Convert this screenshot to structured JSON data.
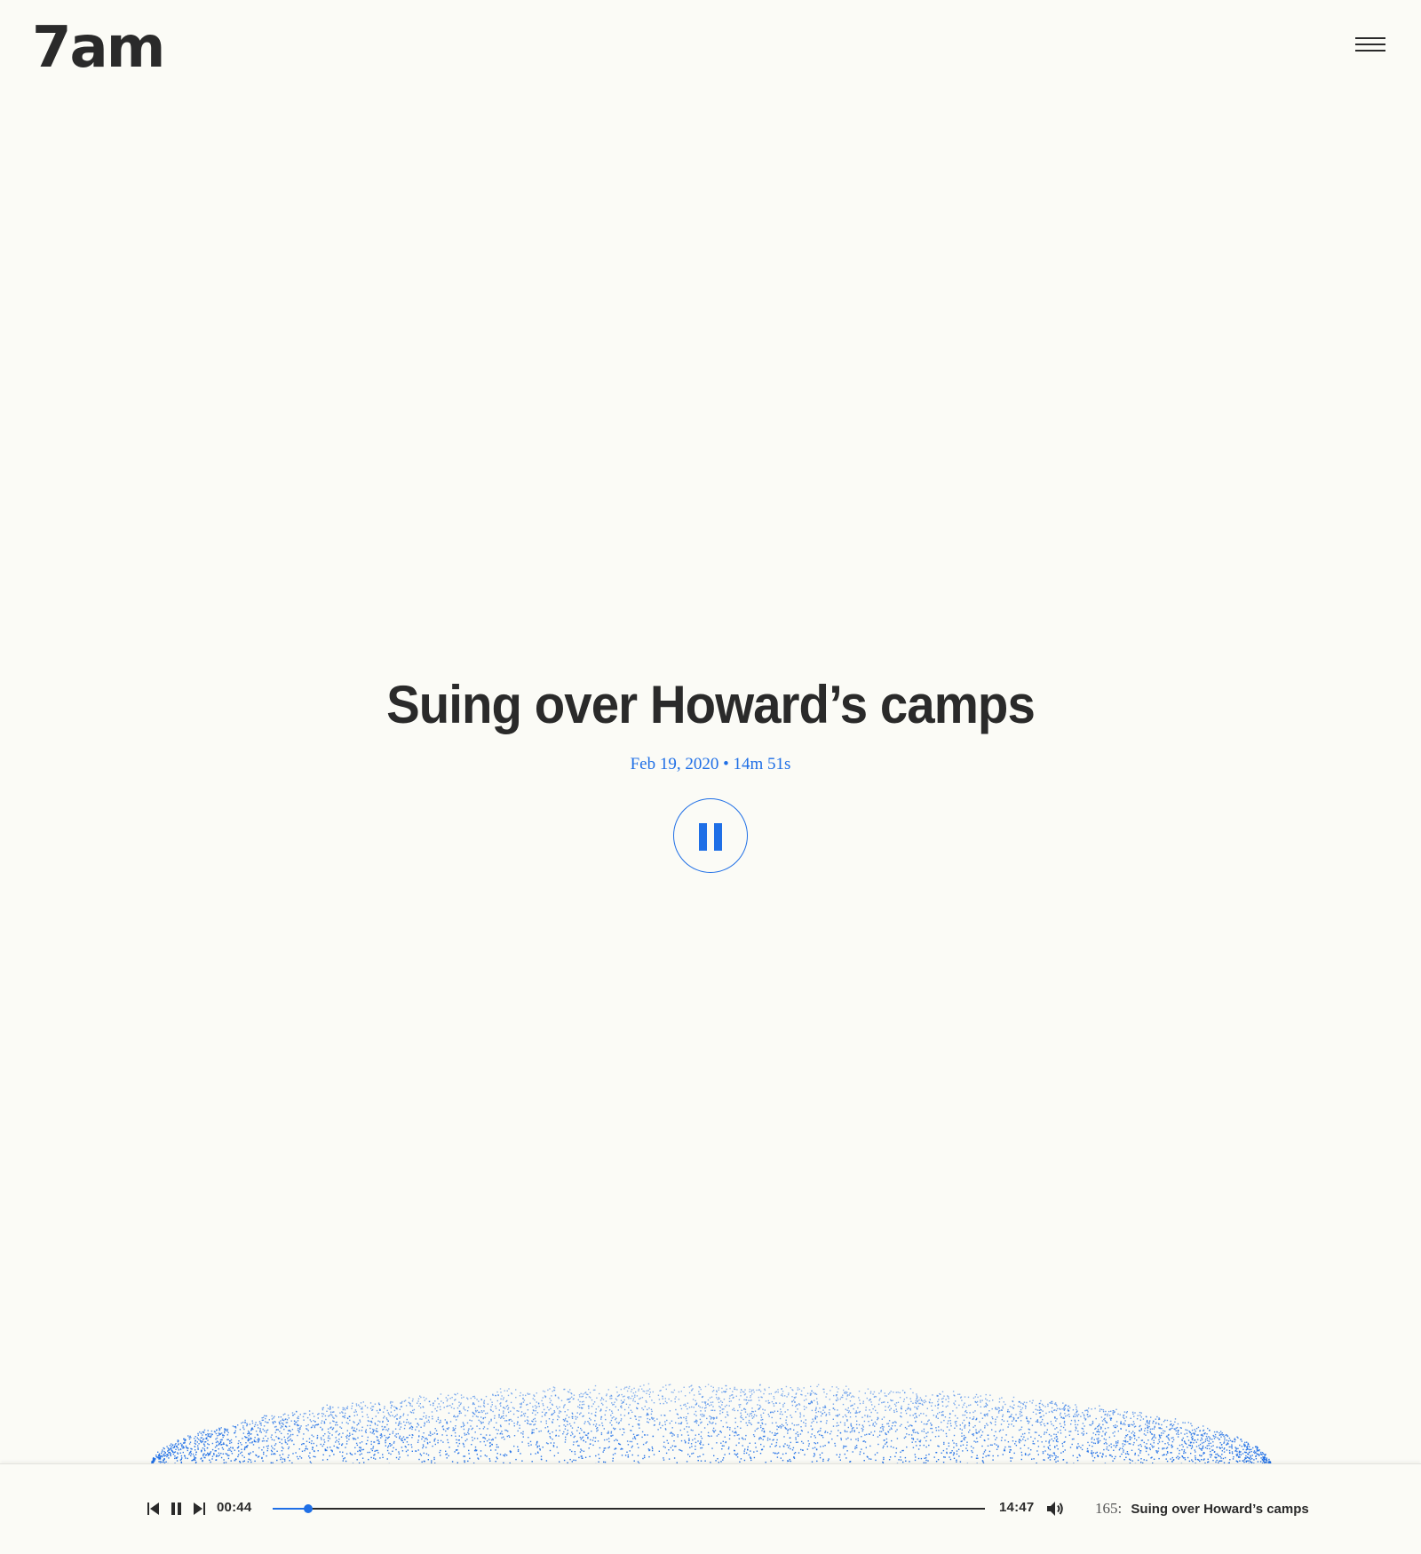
{
  "brand": {
    "logo": "7am"
  },
  "header": {
    "menu_icon": "hamburger-menu-icon"
  },
  "episode": {
    "title": "Suing over Howard’s camps",
    "meta": "Feb 19, 2020 • 14m 51s",
    "play_state_icon": "pause-icon"
  },
  "player": {
    "prev_icon": "skip-previous-icon",
    "pause_icon": "pause-icon",
    "next_icon": "skip-next-icon",
    "current_time": "00:44",
    "total_time": "14:47",
    "progress_fraction": 0.0497,
    "volume_icon": "volume-icon",
    "episode_number": "165:",
    "episode_title": "Suing over Howard’s camps"
  },
  "colors": {
    "accent": "#1f6fe6",
    "text": "#2a2a2a",
    "background": "#fbfbf6"
  }
}
